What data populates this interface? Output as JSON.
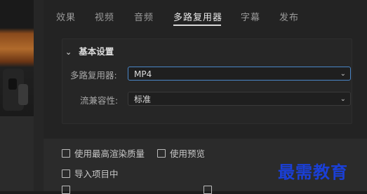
{
  "tabs": [
    {
      "label": "效果"
    },
    {
      "label": "视频"
    },
    {
      "label": "音频"
    },
    {
      "label": "多路复用器"
    },
    {
      "label": "字幕"
    },
    {
      "label": "发布"
    }
  ],
  "active_tab": "多路复用器",
  "section": {
    "title": "基本设置",
    "multiplexer_label": "多路复用器:",
    "multiplexer_value": "MP4",
    "compat_label": "流兼容性:",
    "compat_value": "标准"
  },
  "options": {
    "max_quality": "使用最高渲染质量",
    "use_preview": "使用预览",
    "import_project": "导入项目中"
  },
  "watermark": "最需教育",
  "icons": {
    "collapse": "chevron-down-icon",
    "dropdown": "chevron-down-icon"
  }
}
